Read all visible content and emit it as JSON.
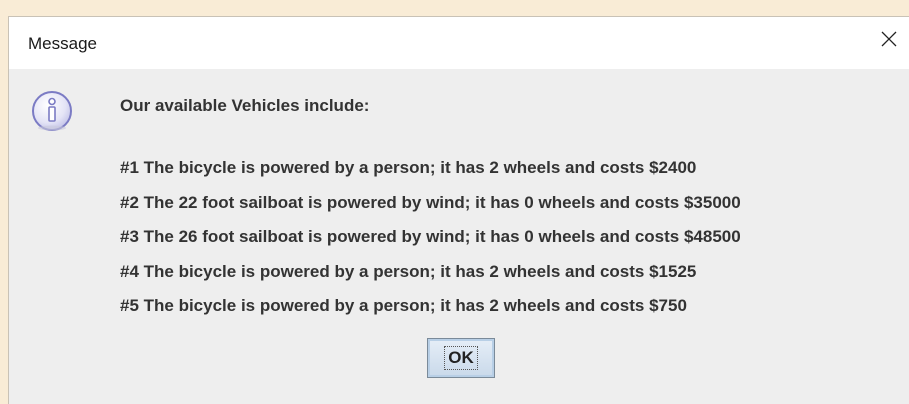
{
  "dialog": {
    "title": "Message",
    "close_icon": "close-icon",
    "info_icon": "info-icon",
    "heading": "Our available Vehicles include:",
    "items": [
      "#1 The bicycle is powered by a person; it has 2 wheels and costs $2400",
      "#2 The 22 foot sailboat is powered by wind; it has 0 wheels and costs $35000",
      "#3 The 26 foot sailboat is powered by wind; it has 0 wheels and costs $48500",
      "#4 The bicycle is powered by a person; it has 2 wheels and costs $1525",
      "#5 The bicycle is powered by a person; it has 2 wheels and costs $750"
    ],
    "ok_label": "OK"
  },
  "colors": {
    "background": "#f9ecd6",
    "dialog_body": "#eeeeee",
    "titlebar": "#ffffff",
    "text": "#333333",
    "icon_accent": "#7b7bc4"
  }
}
